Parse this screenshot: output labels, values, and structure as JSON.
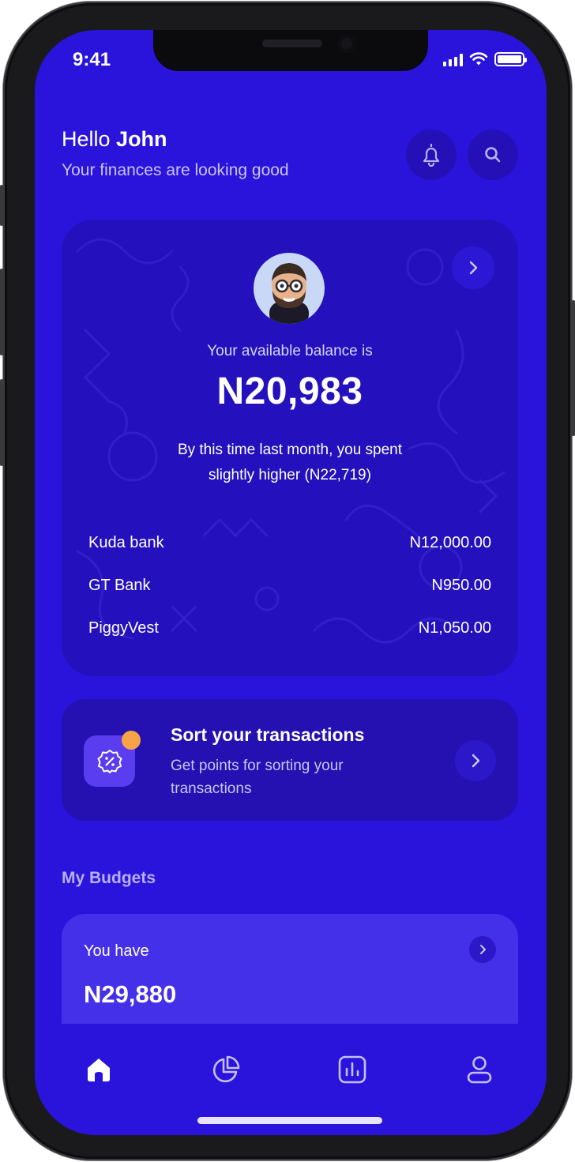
{
  "status_bar": {
    "time": "9:41"
  },
  "header": {
    "greeting_prefix": "Hello",
    "greeting_name": "John",
    "subtitle": "Your finances are looking good",
    "icons": [
      "bell-icon",
      "search-icon"
    ]
  },
  "balance_card": {
    "label": "Your available balance is",
    "amount": "N20,983",
    "comparison_line1": "By this time last month, you spent",
    "comparison_line2": "slightly higher (N22,719)",
    "accounts": [
      {
        "name": "Kuda bank",
        "amount": "N12,000.00"
      },
      {
        "name": "GT Bank",
        "amount": "N950.00"
      },
      {
        "name": "PiggyVest",
        "amount": "N1,050.00"
      }
    ]
  },
  "sort_card": {
    "title": "Sort your transactions",
    "description": "Get points for sorting your transactions",
    "dot_color": "#f7a446"
  },
  "budgets": {
    "section_title": "My Budgets",
    "label": "You have",
    "amount": "N29,880"
  },
  "tab_bar": {
    "tabs": [
      "home-icon",
      "pie-chart-icon",
      "bar-chart-icon",
      "profile-icon"
    ],
    "active": "home-icon"
  },
  "colors": {
    "background": "#2a14dc",
    "card": "#2411bd",
    "accent": "#5b3df0"
  }
}
